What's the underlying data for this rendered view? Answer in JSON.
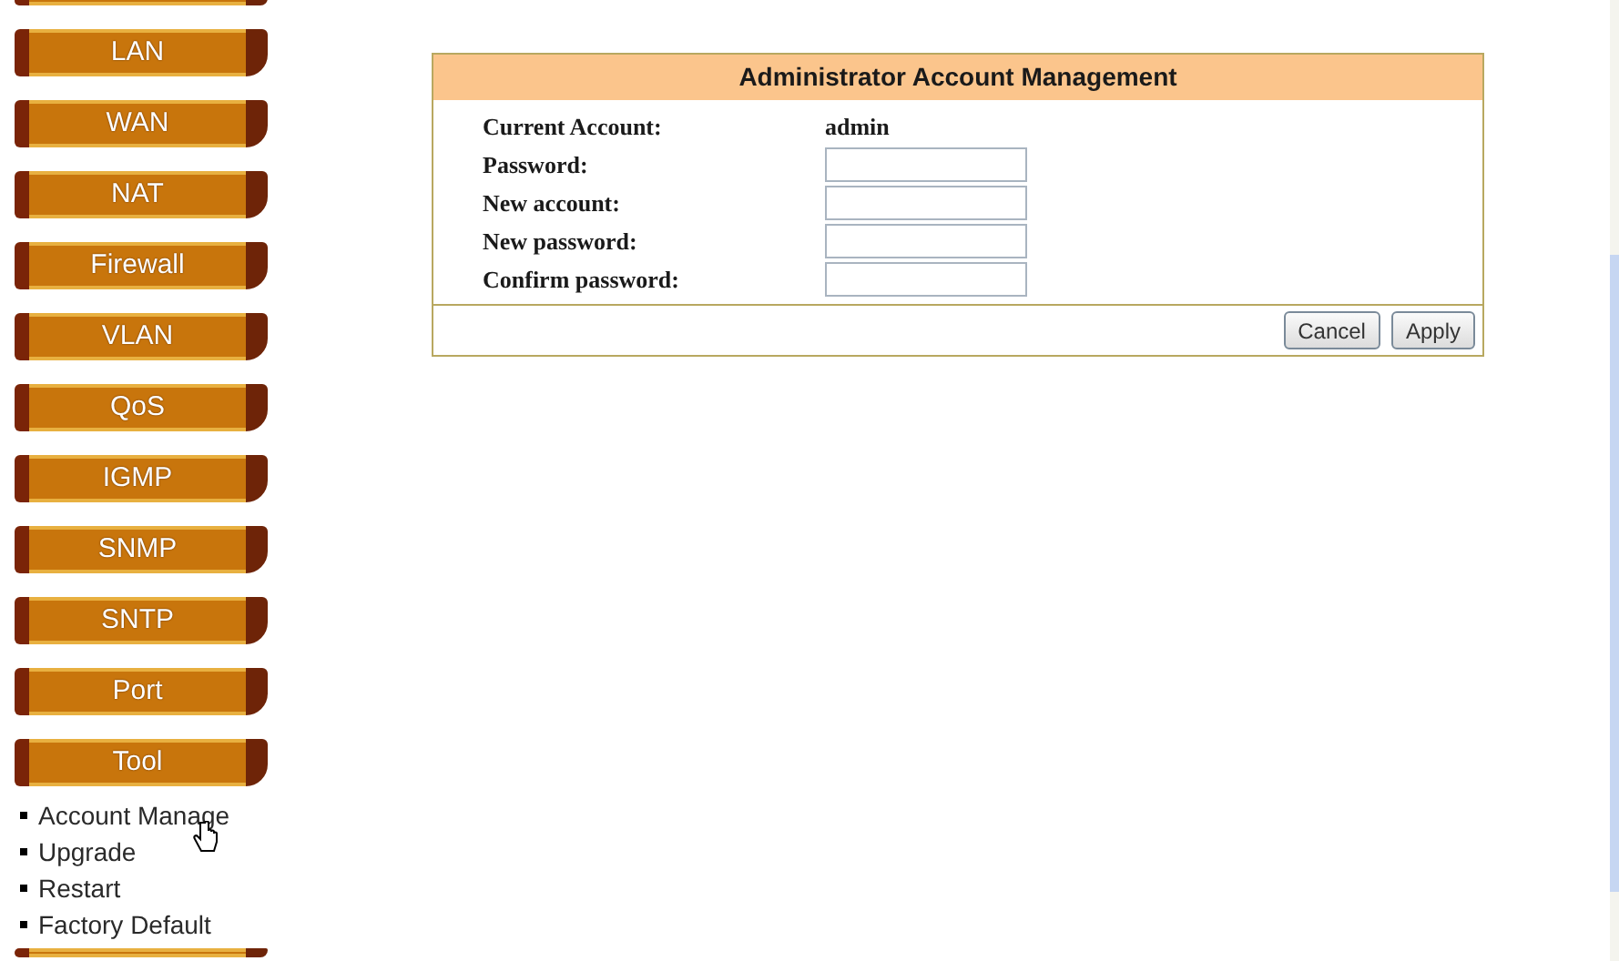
{
  "nav": [
    {
      "label": "LAN"
    },
    {
      "label": "WAN"
    },
    {
      "label": "NAT"
    },
    {
      "label": "Firewall"
    },
    {
      "label": "VLAN"
    },
    {
      "label": "QoS"
    },
    {
      "label": "IGMP"
    },
    {
      "label": "SNMP"
    },
    {
      "label": "SNTP"
    },
    {
      "label": "Port"
    },
    {
      "label": "Tool",
      "submenu": [
        "Account Manage",
        "Upgrade",
        "Restart",
        "Factory Default"
      ]
    }
  ],
  "panel": {
    "title": "Administrator Account Management",
    "rows": [
      {
        "kind": "text",
        "label": "Current Account:",
        "value": "admin"
      },
      {
        "kind": "input",
        "label": "Password:"
      },
      {
        "kind": "input",
        "label": "New account:"
      },
      {
        "kind": "input",
        "label": "New password:"
      },
      {
        "kind": "input",
        "label": "Confirm password:"
      }
    ],
    "buttons": [
      "Cancel",
      "Apply"
    ]
  }
}
